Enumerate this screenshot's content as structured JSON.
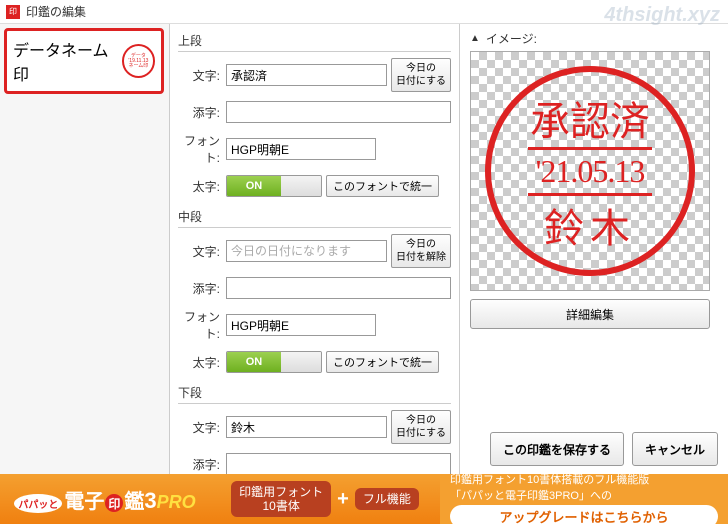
{
  "window": {
    "title": "印鑑の編集"
  },
  "watermark": "4thsight.xyz",
  "left": {
    "stamp_type": "データネーム印"
  },
  "center": {
    "upper": {
      "label": "上段",
      "text_label": "文字:",
      "text_value": "承認済",
      "date_btn": "今日の\n日付にする",
      "soe_label": "添字:",
      "soe_value": "",
      "font_label": "フォント:",
      "font_value": "HGP明朝E",
      "bold_label": "太字:",
      "toggle": "ON",
      "unify": "このフォントで統一"
    },
    "middle": {
      "label": "中段",
      "text_label": "文字:",
      "text_placeholder": "今日の日付になります",
      "date_btn": "今日の\n日付を解除",
      "soe_label": "添字:",
      "soe_value": "",
      "font_label": "フォント:",
      "font_value": "HGP明朝E",
      "bold_label": "太字:",
      "toggle": "ON",
      "unify": "このフォントで統一"
    },
    "lower": {
      "label": "下段",
      "text_label": "文字:",
      "text_value": "鈴木",
      "date_btn": "今日の\n日付にする",
      "soe_label": "添字:",
      "soe_value": ""
    }
  },
  "right": {
    "label": "イメージ:",
    "stamp": {
      "top": "承認済",
      "mid": "'21.05.13",
      "bot": "鈴木"
    },
    "detail": "詳細編集",
    "save": "この印鑑を保存する",
    "cancel": "キャンセル"
  },
  "banner": {
    "logo_bub": "パパッと",
    "logo_a": "電子",
    "logo_in": "印",
    "logo_b": "鑑",
    "logo_num": "3",
    "logo_pro": "PRO",
    "feat1": "印鑑用フォント\n10書体",
    "feat2": "フル機能",
    "line1": "印鑑用フォント10書体搭載のフル機能版",
    "line2": "「パパッと電子印鑑3PRO」への",
    "upgrade": "アップグレードはこちらから"
  }
}
